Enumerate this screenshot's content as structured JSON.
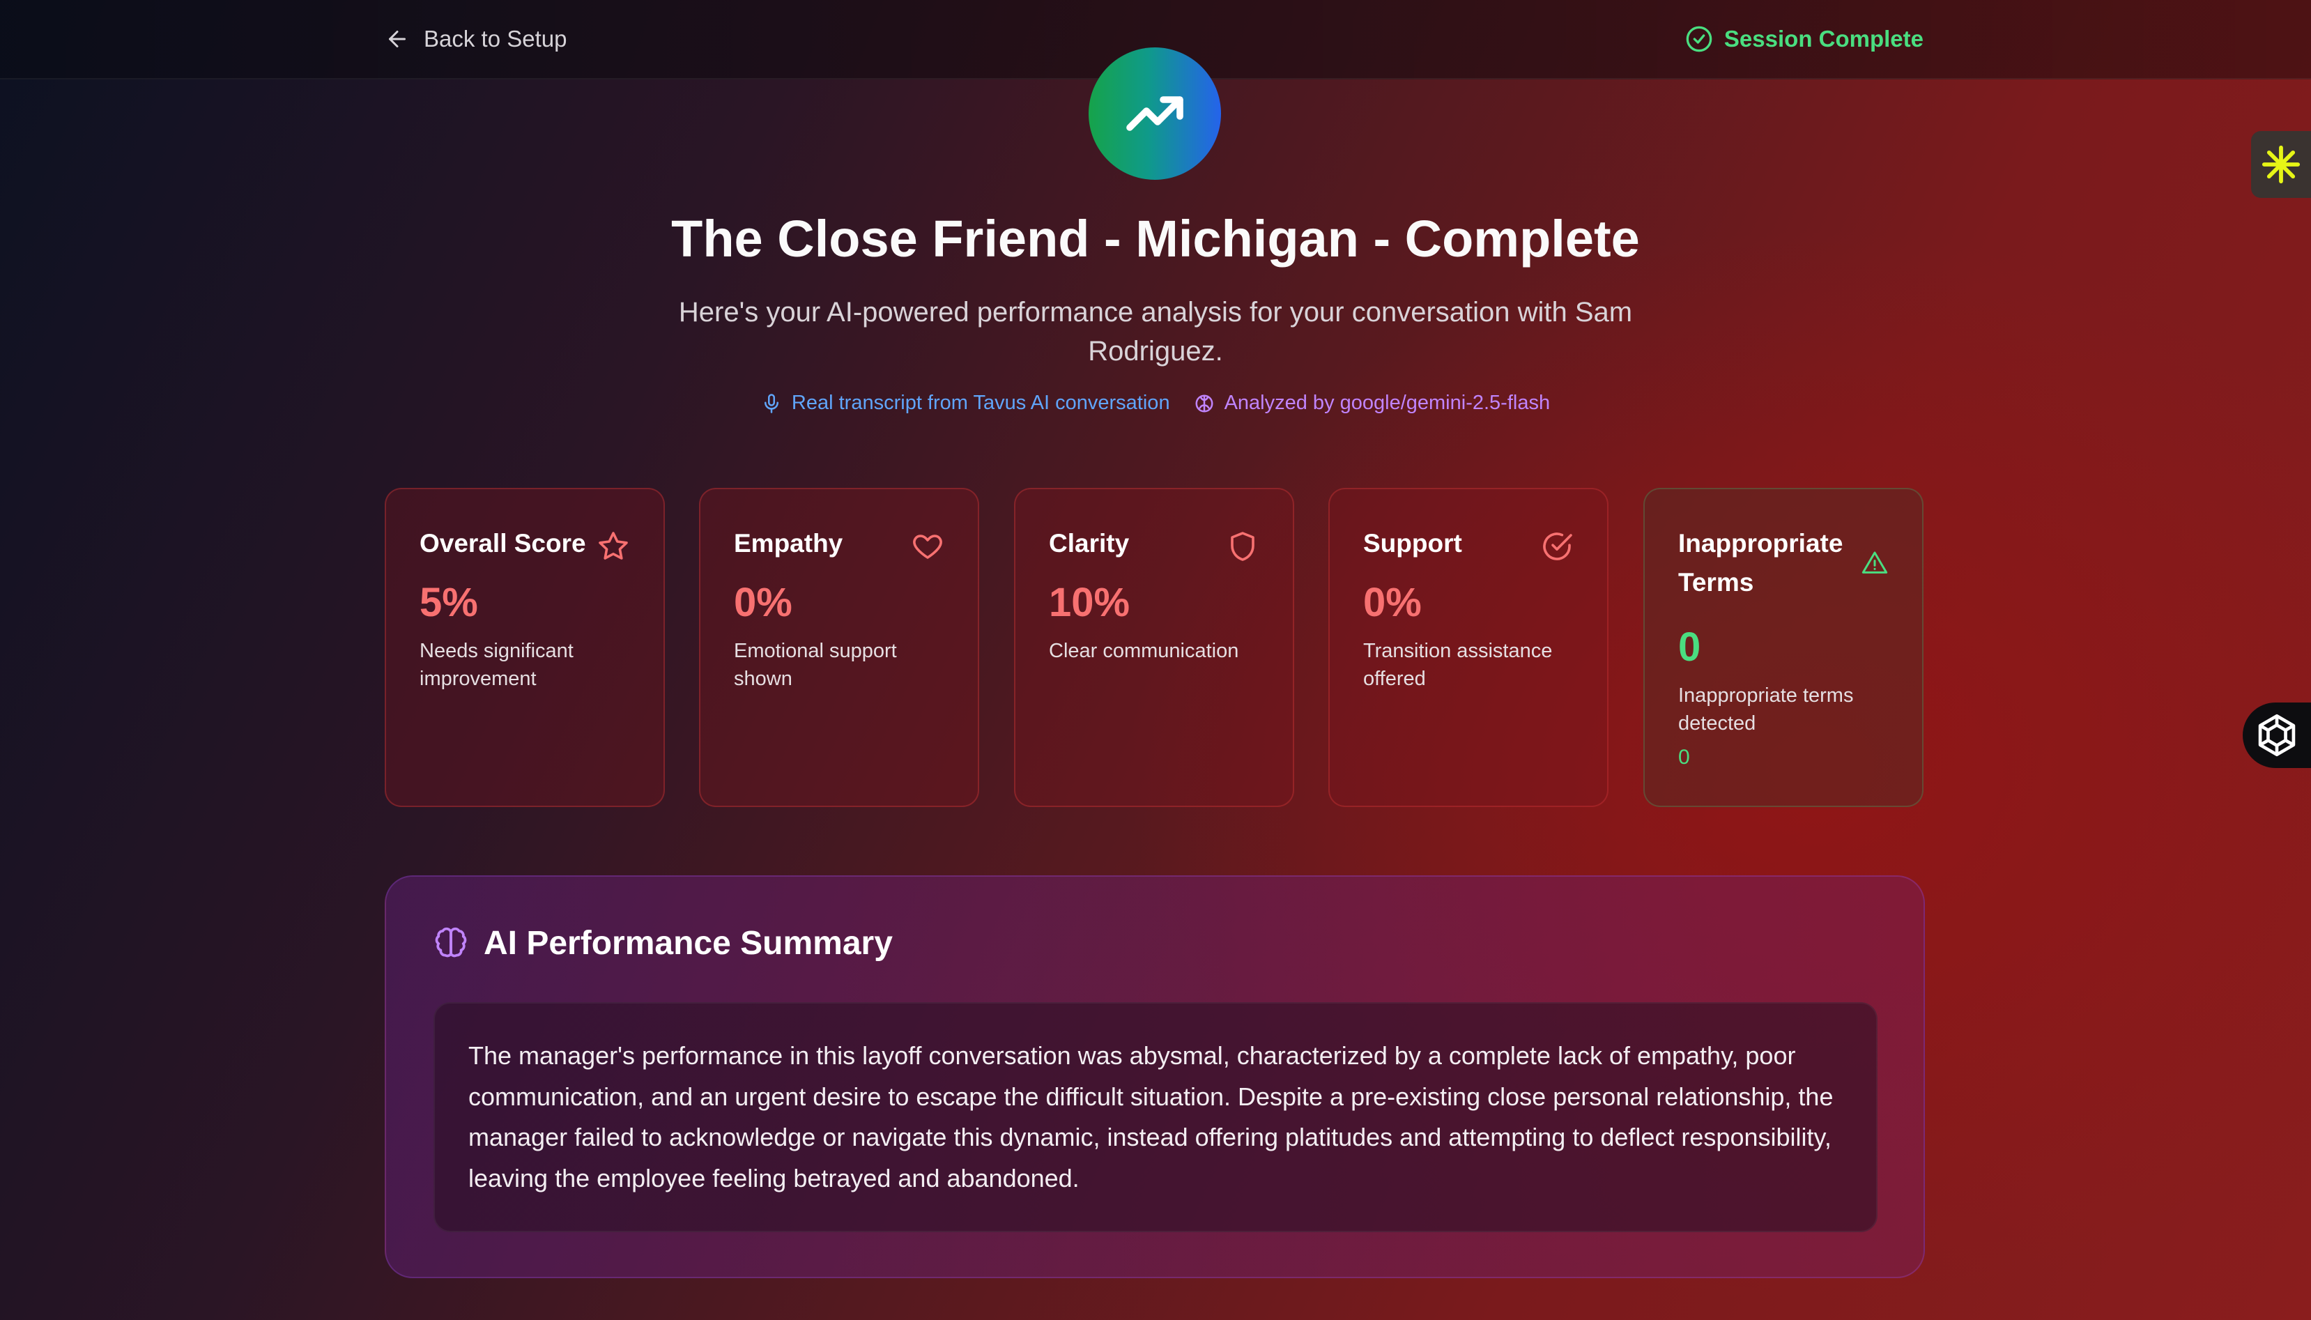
{
  "header": {
    "back_label": "Back to Setup",
    "status_label": "Session Complete"
  },
  "hero": {
    "title": "The Close Friend - Michigan - Complete",
    "subtitle": "Here's your AI-powered performance analysis for your conversation with Sam Rodriguez.",
    "transcript_note": "Real transcript from Tavus AI conversation",
    "model_note": "Analyzed by google/gemini-2.5-flash"
  },
  "metrics": [
    {
      "name": "Overall Score",
      "value": "5%",
      "desc": "Needs significant improvement",
      "icon": "star-icon"
    },
    {
      "name": "Empathy",
      "value": "0%",
      "desc": "Emotional support shown",
      "icon": "heart-icon"
    },
    {
      "name": "Clarity",
      "value": "10%",
      "desc": "Clear communication",
      "icon": "shield-icon"
    },
    {
      "name": "Support",
      "value": "0%",
      "desc": "Transition assistance offered",
      "icon": "check-circle-icon"
    },
    {
      "name": "Inappropriate Terms",
      "value": "0",
      "desc": "Inappropriate terms detected",
      "extra": "0",
      "icon": "warning-triangle-icon"
    }
  ],
  "summary": {
    "title": "AI Performance Summary",
    "text": "The manager's performance in this layoff conversation was abysmal, characterized by a complete lack of empathy, poor communication, and an urgent desire to escape the difficult situation. Despite a pre-existing close personal relationship, the manager failed to acknowledge or navigate this dynamic, instead offering platitudes and attempting to deflect responsibility, leaving the employee feeling betrayed and abandoned."
  },
  "colors": {
    "accent_red": "#f87171",
    "accent_green": "#4ade80",
    "accent_blue": "#60a5fa",
    "accent_purple": "#c084fc"
  }
}
